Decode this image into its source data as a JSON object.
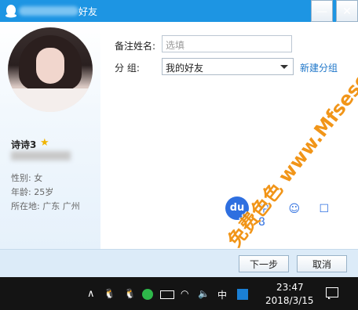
{
  "window": {
    "title": "好友",
    "minimize_glyph": "—",
    "close_glyph": "✕"
  },
  "profile": {
    "nickname": "诗诗3",
    "gender": "性别: 女",
    "age": "年龄: 25岁",
    "location": "所在地: 广东  广州"
  },
  "form": {
    "remark_label": "备注姓名:",
    "remark_placeholder": "选填",
    "group_label": "分     组:",
    "group_value": "我的好友",
    "new_group_link": "新建分组"
  },
  "buttons": {
    "next": "下一步",
    "cancel": "取消"
  },
  "watermark": {
    "baidu_badge": "du",
    "baidu_icons": "中 ☺ ☐ 8",
    "site_text": "免费色色 www.Mfsese.com"
  },
  "taskbar": {
    "ime": "中",
    "time": "23:47",
    "date": "2018/3/15"
  },
  "colors": {
    "titlebar": "#1d95e3",
    "link": "#1e76c9",
    "watermark": "#f08a00"
  }
}
